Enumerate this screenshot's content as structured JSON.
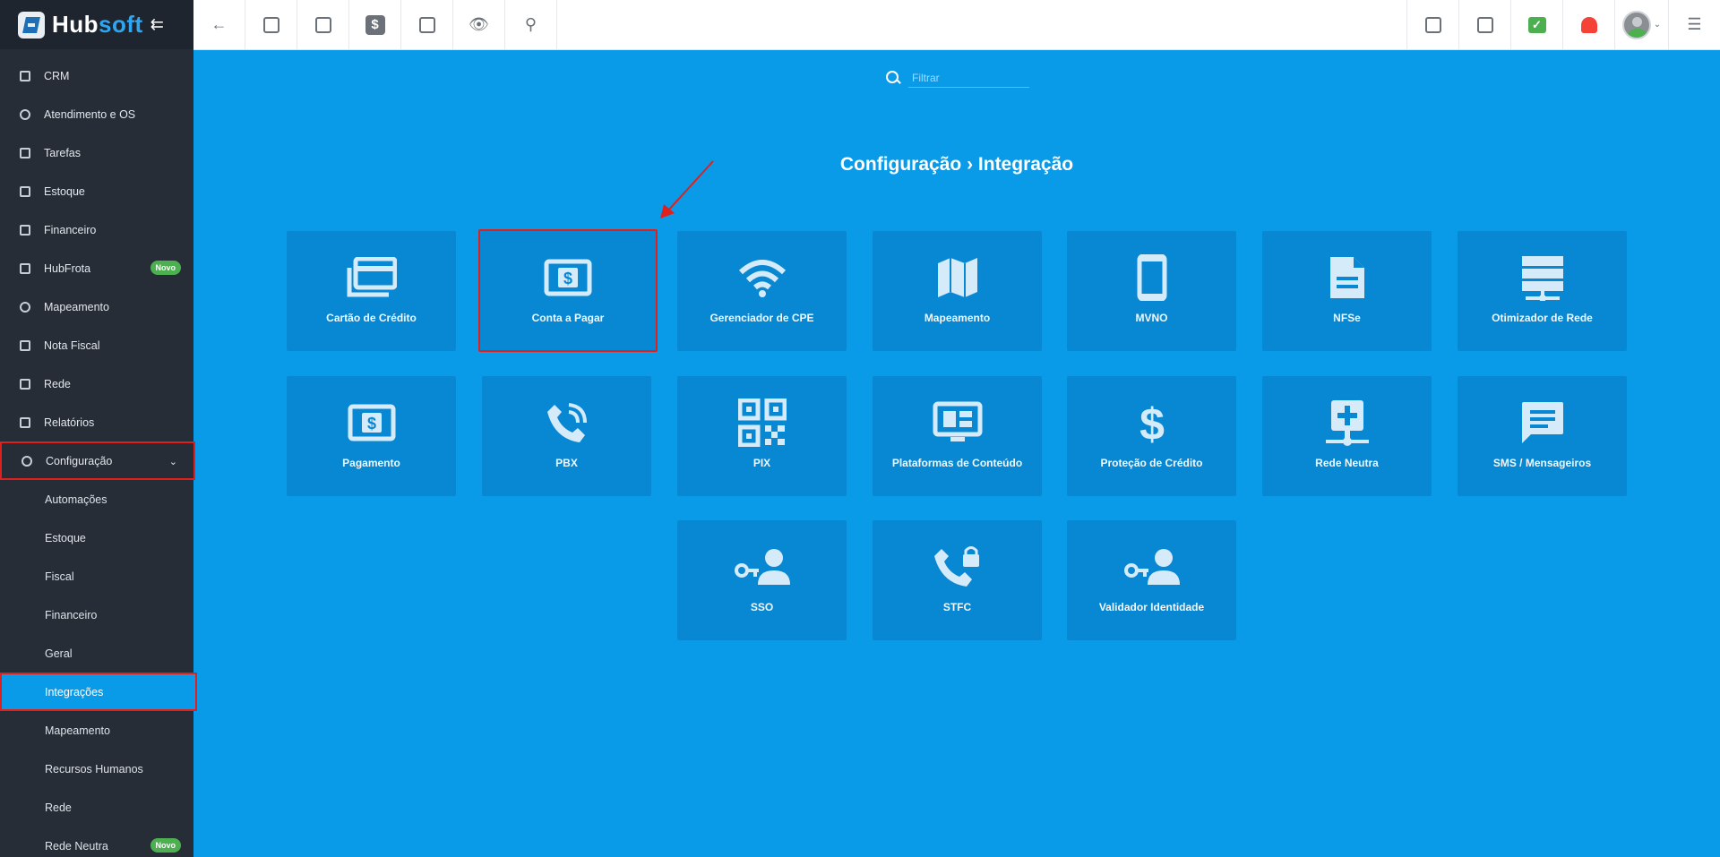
{
  "app": {
    "brand_hub": "Hub",
    "brand_soft": "soft"
  },
  "sidebar": {
    "items": [
      {
        "label": "CRM",
        "icon": "crm-icon"
      },
      {
        "label": "Atendimento e OS",
        "icon": "service-icon"
      },
      {
        "label": "Tarefas",
        "icon": "tasks-icon"
      },
      {
        "label": "Estoque",
        "icon": "box-icon"
      },
      {
        "label": "Financeiro",
        "icon": "money-icon"
      },
      {
        "label": "HubFrota",
        "icon": "car-icon",
        "badge": "Novo"
      },
      {
        "label": "Mapeamento",
        "icon": "map-pin-icon"
      },
      {
        "label": "Nota Fiscal",
        "icon": "document-icon"
      },
      {
        "label": "Rede",
        "icon": "network-icon"
      },
      {
        "label": "Relatórios",
        "icon": "report-icon"
      },
      {
        "label": "Configuração",
        "icon": "gear-icon"
      }
    ],
    "sub_items": [
      {
        "label": "Automações"
      },
      {
        "label": "Estoque"
      },
      {
        "label": "Fiscal"
      },
      {
        "label": "Financeiro"
      },
      {
        "label": "Geral"
      },
      {
        "label": "Integrações"
      },
      {
        "label": "Mapeamento"
      },
      {
        "label": "Recursos Humanos"
      },
      {
        "label": "Rede"
      },
      {
        "label": "Rede Neutra",
        "badge": "Novo"
      }
    ]
  },
  "topbar": {
    "left_icons": [
      "back-arrow-icon",
      "contact-icon",
      "calendar-clock-icon",
      "dollar-icon",
      "terminal-icon",
      "eye-icon",
      "search-icon"
    ],
    "right_icons": [
      "pdf-icon",
      "building-icon",
      "check-icon",
      "bell-icon",
      "avatar",
      "list-icon"
    ]
  },
  "main": {
    "filter_placeholder": "Filtrar",
    "breadcrumb_root": "Configuração",
    "breadcrumb_sep": "›",
    "breadcrumb_current": "Integração",
    "cards": [
      {
        "label": "Cartão de Crédito",
        "icon": "credit-card-icon"
      },
      {
        "label": "Conta a Pagar",
        "icon": "bill-dollar-icon"
      },
      {
        "label": "Gerenciador de CPE",
        "icon": "wifi-icon"
      },
      {
        "label": "Mapeamento",
        "icon": "map-icon"
      },
      {
        "label": "MVNO",
        "icon": "phone-icon"
      },
      {
        "label": "NFSe",
        "icon": "file-icon"
      },
      {
        "label": "Otimizador de Rede",
        "icon": "server-icon"
      },
      {
        "label": "Pagamento",
        "icon": "payment-icon"
      },
      {
        "label": "PBX",
        "icon": "phone-call-icon"
      },
      {
        "label": "PIX",
        "icon": "qr-code-icon"
      },
      {
        "label": "Plataformas de Conteúdo",
        "icon": "monitor-icon"
      },
      {
        "label": "Proteção de Crédito",
        "icon": "dollar-sign-icon"
      },
      {
        "label": "Rede Neutra",
        "icon": "network-plus-icon"
      },
      {
        "label": "SMS / Mensageiros",
        "icon": "message-icon"
      },
      {
        "label": "SSO",
        "icon": "key-user-icon"
      },
      {
        "label": "STFC",
        "icon": "phone-lock-icon"
      },
      {
        "label": "Validador Identidade",
        "icon": "key-user-icon"
      }
    ]
  },
  "colors": {
    "sidebar_bg": "#262d37",
    "main_bg": "#0a9be8",
    "card_bg": "#0888d2",
    "highlight": "#e0201e",
    "badge": "#4caf50"
  }
}
